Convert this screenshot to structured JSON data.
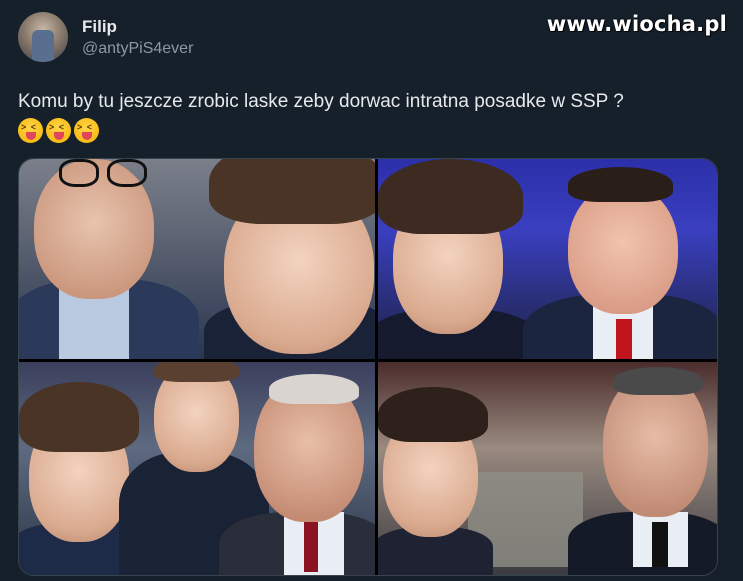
{
  "author": {
    "display_name": "Filip",
    "handle": "@antyPiS4ever"
  },
  "watermark": "www.wiocha.pl",
  "tweet": {
    "text": "Komu by tu jeszcze zrobic laske zeby dorwac intratna posadke w SSP ?",
    "emoji_count": 3,
    "emoji_name": "squinting-face-with-tongue"
  },
  "media": {
    "photo_count": 4
  },
  "colors": {
    "background": "#15202b",
    "text": "#e7e9ea",
    "secondary_text": "#8b98a5"
  }
}
